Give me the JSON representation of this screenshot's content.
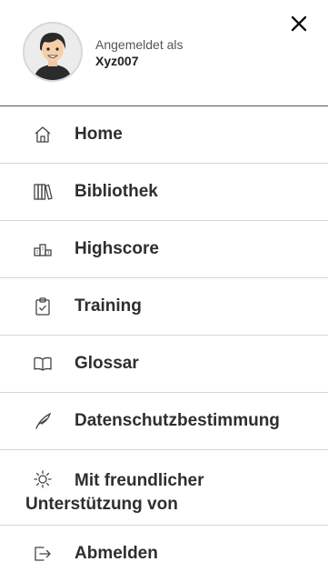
{
  "header": {
    "logged_in_label": "Angemeldet als",
    "username": "Xyz007",
    "close_icon": "close-icon"
  },
  "menu": {
    "items": [
      {
        "label": "Home",
        "icon": "home-icon"
      },
      {
        "label": "Bibliothek",
        "icon": "library-icon"
      },
      {
        "label": "Highscore",
        "icon": "podium-icon"
      },
      {
        "label": "Training",
        "icon": "clipboard-check-icon"
      },
      {
        "label": "Glossar",
        "icon": "book-open-icon"
      },
      {
        "label": "Datenschutzbestimmung",
        "icon": "feather-icon"
      },
      {
        "label": "Mit freundlicher Unterstützung von",
        "icon": "sun-icon"
      },
      {
        "label": "Abmelden",
        "icon": "logout-icon"
      }
    ]
  },
  "colors": {
    "text": "#2e2e2e",
    "divider": "#d6d6d6",
    "header_divider": "#555555"
  }
}
